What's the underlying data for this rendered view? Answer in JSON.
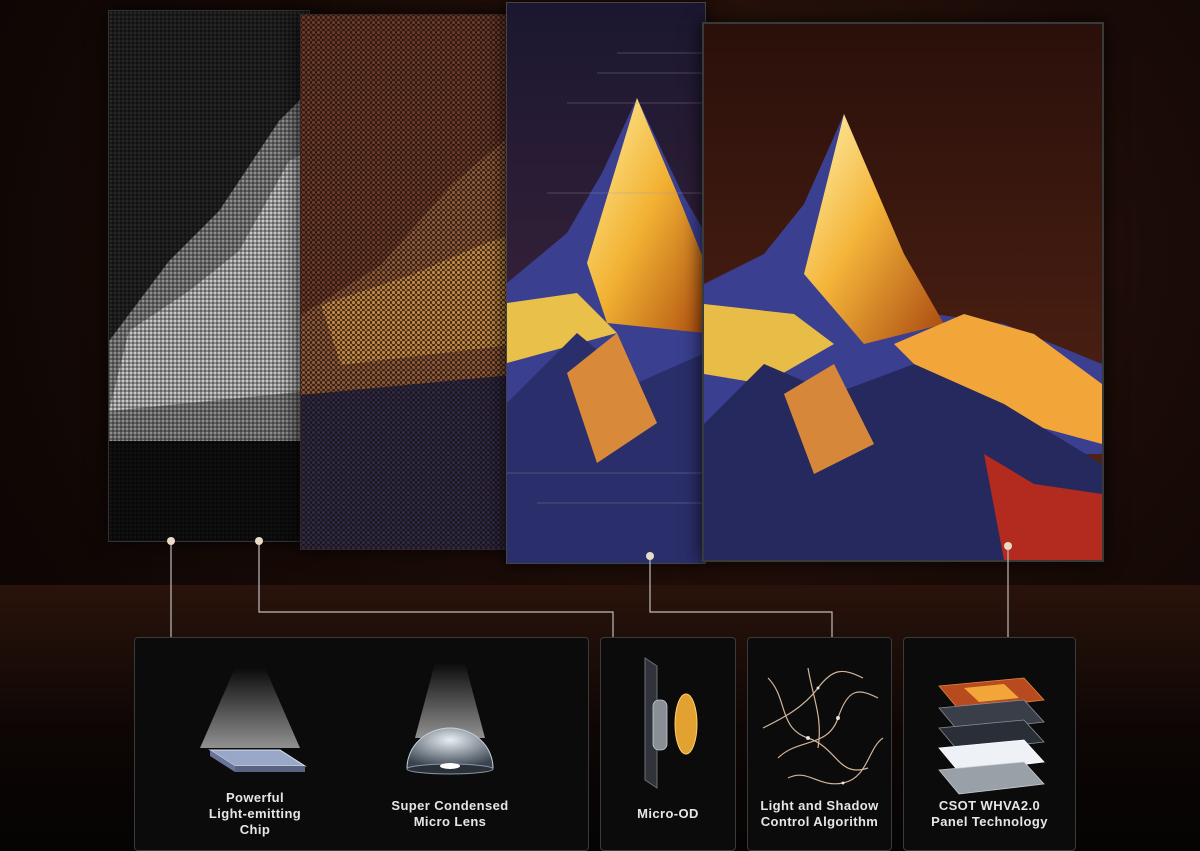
{
  "components": [
    {
      "line1": "Powerful",
      "line2": "Light-emitting",
      "line3": "Chip",
      "icon": "led-chip-icon"
    },
    {
      "line1": "Super Condensed",
      "line2": "Micro Lens",
      "icon": "micro-lens-icon"
    },
    {
      "line1": "Micro-OD",
      "icon": "micro-od-icon"
    },
    {
      "line1": "Light and Shadow",
      "line2": "Control Algorithm",
      "icon": "light-algorithm-icon"
    },
    {
      "line1": "CSOT WHVA2.0",
      "line2": "Panel Technology",
      "icon": "panel-stack-icon"
    }
  ],
  "colors": {
    "connector": "#bdbdbd",
    "accent_gold": "#f2b233",
    "mountain_shadow": "#3a3f8f"
  }
}
